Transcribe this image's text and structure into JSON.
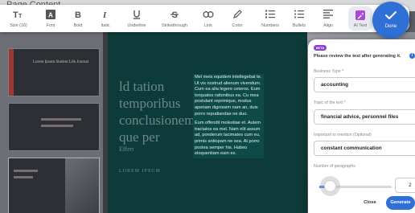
{
  "editor": {
    "page_title": "Page Content",
    "slide": {
      "title": "ld tation temporibus conclusionem que per",
      "subtitle": "Effert",
      "caption": "LOREM IPSUM",
      "body_p1": "Mel meis equidem intellegebat te. Ut vix nostrud alienum vivendum. Cum ea alia legere ceteros. Eum torquatos rationibus ea. Cu mea postulant reprimique, modus aperiam dignissim nam an, duis porro repudiandae ne duo.",
      "body_p2": "Eum offendit molestiae et. Autem tractatos ea mel. Nam elit assum ad, ponderum tacimates cum eu, primis antiopam ne sea. At porro postea semper his. Habeo eloquentiam eam ex."
    },
    "thumbnail": {
      "label": "Lorem Ipsum Student Life Journal"
    }
  },
  "toolbar": {
    "items": [
      {
        "label": "Size (16)",
        "icon": "text-size-icon"
      },
      {
        "label": "Font",
        "icon": "font-icon"
      },
      {
        "label": "Bold",
        "icon": "bold-icon"
      },
      {
        "label": "Italic",
        "icon": "italic-icon"
      },
      {
        "label": "Underline",
        "icon": "underline-icon"
      },
      {
        "label": "Strikethrough",
        "icon": "strikethrough-icon"
      },
      {
        "label": "Link",
        "icon": "link-icon"
      },
      {
        "label": "Color",
        "icon": "color-icon"
      },
      {
        "label": "Numbers",
        "icon": "numbered-list-icon"
      },
      {
        "label": "Bullets",
        "icon": "bulleted-list-icon"
      },
      {
        "label": "Align",
        "icon": "align-icon"
      },
      {
        "label": "AI Text",
        "icon": "ai-text-icon"
      }
    ],
    "done_label": "Done",
    "colors": {
      "accent": "#2f6fd6",
      "ai": "#a94ad6"
    }
  },
  "ai_panel": {
    "badge": "BETA",
    "instruction": "Please review the text after generating it.",
    "business_type_label": "Business Type *",
    "business_type_value": "accounting",
    "topic_label": "Topic of the text *",
    "topic_value": "financial advice, personnel files",
    "mention_label": "Important to mention (Optional)",
    "mention_value": "constant communication",
    "paragraphs_label": "Number of paragraphs",
    "paragraphs_value": "2",
    "paragraphs_fraction": 0.15,
    "close_label": "Close",
    "generate_label": "Generate"
  }
}
